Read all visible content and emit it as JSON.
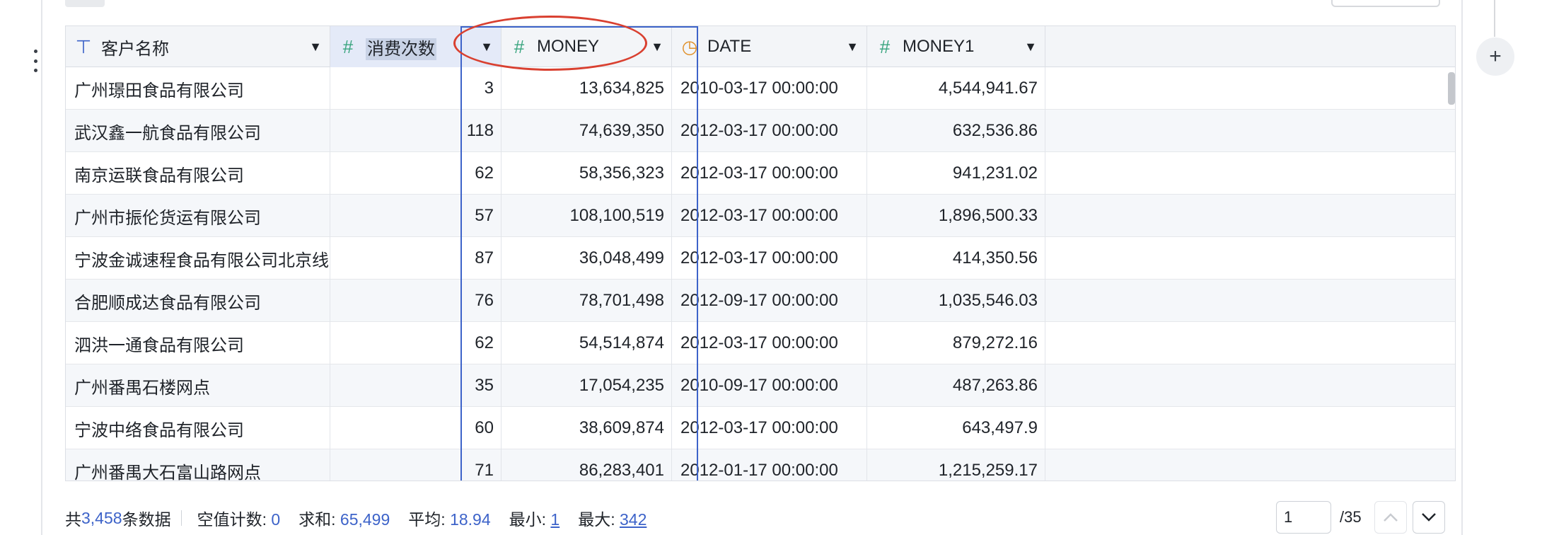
{
  "table": {
    "columns": [
      {
        "name": "客户名称",
        "type_icon": "text-type-icon",
        "glyph": "⊤",
        "icon_color": "#3d63c9"
      },
      {
        "name": "消费次数",
        "type_icon": "number-type-icon",
        "glyph": "#",
        "icon_color": "#3aa57f"
      },
      {
        "name": "MONEY",
        "type_icon": "number-type-icon",
        "glyph": "#",
        "icon_color": "#3aa57f"
      },
      {
        "name": "DATE",
        "type_icon": "clock-icon",
        "glyph": "◷",
        "icon_color": "#e0902a"
      },
      {
        "name": "MONEY1",
        "type_icon": "number-type-icon",
        "glyph": "#",
        "icon_color": "#3aa57f"
      }
    ],
    "selected_column": "消费次数",
    "rows": [
      [
        "广州璟田食品有限公司",
        "3",
        "13,634,825",
        "2010-03-17 00:00:00",
        "4,544,941.67"
      ],
      [
        "武汉鑫一航食品有限公司",
        "118",
        "74,639,350",
        "2012-03-17 00:00:00",
        "632,536.86"
      ],
      [
        "南京运联食品有限公司",
        "62",
        "58,356,323",
        "2012-03-17 00:00:00",
        "941,231.02"
      ],
      [
        "广州市振伦货运有限公司",
        "57",
        "108,100,519",
        "2012-03-17 00:00:00",
        "1,896,500.33"
      ],
      [
        "宁波金诚速程食品有限公司北京线",
        "87",
        "36,048,499",
        "2012-03-17 00:00:00",
        "414,350.56"
      ],
      [
        "合肥顺成达食品有限公司",
        "76",
        "78,701,498",
        "2012-09-17 00:00:00",
        "1,035,546.03"
      ],
      [
        "泗洪一通食品有限公司",
        "62",
        "54,514,874",
        "2012-03-17 00:00:00",
        "879,272.16"
      ],
      [
        "广州番禺石楼网点",
        "35",
        "17,054,235",
        "2010-09-17 00:00:00",
        "487,263.86"
      ],
      [
        "宁波中络食品有限公司",
        "60",
        "38,609,874",
        "2012-03-17 00:00:00",
        "643,497.9"
      ],
      [
        "广州番禺大石富山路网点",
        "71",
        "86,283,401",
        "2012-01-17 00:00:00",
        "1,215,259.17"
      ]
    ]
  },
  "footer": {
    "total_prefix": "共",
    "total_count": "3,458",
    "total_suffix": "条数据",
    "null_label": "空值计数:",
    "null_value": "0",
    "sum_label": "求和:",
    "sum_value": "65,499",
    "avg_label": "平均:",
    "avg_value": "18.94",
    "min_label": "最小:",
    "min_value": "1",
    "max_label": "最大:",
    "max_value": "342"
  },
  "pager": {
    "current_page": "1",
    "total_pages": "/35",
    "prev_icon": "chevron-up-icon",
    "next_icon": "chevron-down-icon"
  },
  "add_column_label": "+",
  "colors": {
    "selection": "#3d63c9",
    "annotation": "#d94030",
    "stat_value": "#3d63c9"
  }
}
